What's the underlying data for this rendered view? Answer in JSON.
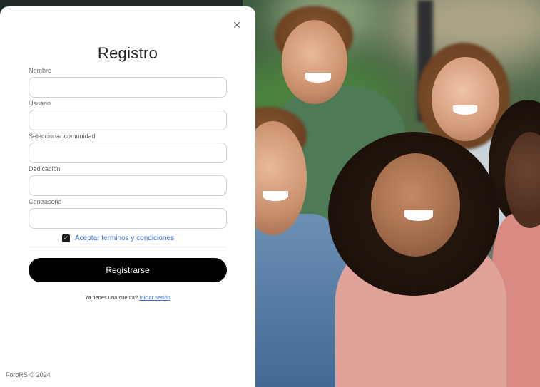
{
  "modal": {
    "close_icon": "×",
    "title": "Registro",
    "fields": [
      {
        "label": "Nombre",
        "value": "",
        "placeholder": ""
      },
      {
        "label": "Usuario",
        "value": "",
        "placeholder": ""
      },
      {
        "label": "Seleccionar comunidad",
        "value": "",
        "placeholder": ""
      },
      {
        "label": "Dedicacion",
        "value": "",
        "placeholder": ""
      },
      {
        "label": "Contraseñá",
        "value": "",
        "placeholder": ""
      }
    ],
    "terms": {
      "checked": true,
      "check_glyph": "✓",
      "label": "Aceptar terminos y condiciones"
    },
    "submit_label": "Registrarse",
    "login_prompt": "Ya tienes una cuenta?",
    "login_link": "Iniciar sesión",
    "footer": "ForoRS © 2024"
  },
  "colors": {
    "accent": "#000000",
    "link": "#3b6fd1",
    "card_bg": "#ffffff"
  },
  "icons": {
    "close": "close-icon",
    "checkbox": "checkbox-checked-icon"
  }
}
